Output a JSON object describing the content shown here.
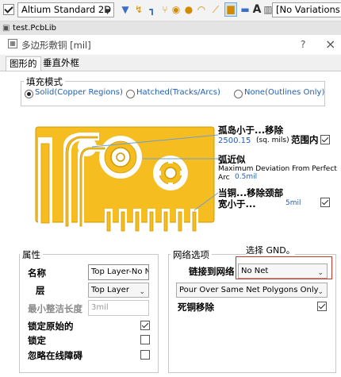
{
  "toolbar": {
    "view_select": "Altium Standard 2D",
    "variations_select": "[No Variations]",
    "icons": [
      "filter-icon",
      "route-icon",
      "interactive-route-icon",
      "via-icon",
      "pad-icon",
      "arc-icon",
      "polygon-icon",
      "region-icon",
      "text-icon",
      "grid-icon"
    ]
  },
  "document_tab": "test.PcbLib",
  "dialog": {
    "title": "多边形敷铜 [mil]",
    "help_label": "?",
    "close_label": "×"
  },
  "tabs": [
    {
      "label": "图形的",
      "active": true
    },
    {
      "label": "垂直外框",
      "active": false
    }
  ],
  "fill_mode": {
    "legend": "填充模式",
    "options": [
      {
        "label": "Solid(Copper Regions)",
        "selected": true
      },
      {
        "label": "Hatched(Tracks/Arcs)",
        "selected": false
      },
      {
        "label": "None(Outlines Only)",
        "selected": false
      }
    ]
  },
  "graphic": {
    "island_title": "孤岛小于...移除",
    "island_value": "2500.15",
    "island_unit": "(sq. mils)",
    "island_scope_label": "范围内",
    "island_checked": true,
    "arc_title": "弧近似",
    "arc_desc": "Maximum Deviation From Perfect",
    "arc_prefix": "Arc",
    "arc_value": "0.5mil",
    "neck_title_1": "当铜...移除颈部",
    "neck_title_2": "宽小于...",
    "neck_value": "5mil",
    "neck_checked": true,
    "colors": {
      "copper": "#f5bd1f",
      "edge": "#cf9a00",
      "cut": "#ffffff",
      "leader": "#6a9fd8"
    }
  },
  "properties": {
    "legend": "属性",
    "name_label": "名称",
    "name_value": "Top Layer-No Net",
    "layer_label": "层",
    "layer_value": "Top Layer",
    "min_len_label": "最小整洁长度",
    "min_len_value": "3mil",
    "lock_primitives_label": "锁定原始的",
    "lock_primitives_checked": true,
    "locked_label": "锁定",
    "locked_checked": false,
    "ignore_obstacles_label": "忽略在线障碍",
    "ignore_obstacles_checked": false
  },
  "net_options": {
    "legend": "网络选项",
    "connect_label": "链接到网络",
    "connect_value": "No Net",
    "pour_value": "Pour Over Same Net Polygons Only",
    "remove_dead_label": "死铜移除",
    "remove_dead_checked": true
  },
  "annotation": {
    "text": "选择 GND。",
    "color": "#c0392b"
  }
}
